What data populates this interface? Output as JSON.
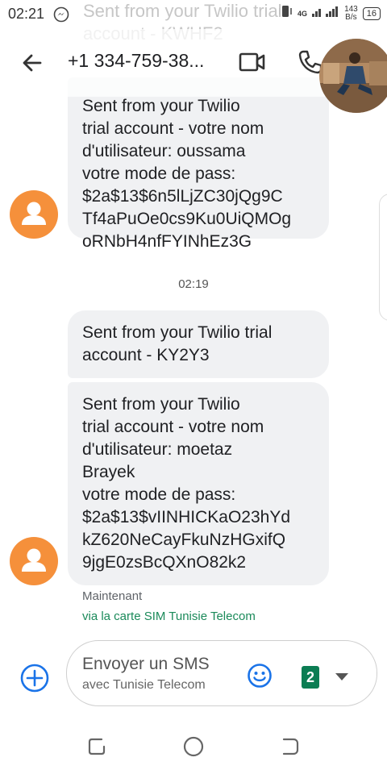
{
  "status_bar": {
    "time": "02:21",
    "network": "4G",
    "speed_value": "143",
    "speed_unit": "B/s",
    "battery": "16"
  },
  "background_text": "Sent from your Twilio trial\naccount - KWHF2",
  "header": {
    "phone_number": "+1 334-759-38...",
    "back_icon": "arrow-left-icon",
    "video_icon": "video-call-icon",
    "call_icon": "phone-icon"
  },
  "messages": [
    {
      "text": "Sent from your Twilio\ntrial account - votre nom\nd'utilisateur: oussama\nvotre mode de pass:\n$2a$13$6n5lLjZC30jQg9C\nTf4aPuOe0cs9Ku0UiQMOg\noRNbH4nfFYINhEz3G"
    },
    {
      "text": "Sent from your Twilio trial\naccount - KY2Y3"
    },
    {
      "text": "Sent from your Twilio\ntrial account - votre nom\nd'utilisateur: moetaz\nBrayek\nvotre mode de pass:\n$2a$13$vIINHICKaO23hYd\nkZ620NeCayFkuNzHGxifQ\n9jgE0zsBcQXnO82k2"
    }
  ],
  "separator_time": "02:19",
  "meta": {
    "status": "Maintenant",
    "sim": "via la carte SIM Tunisie Telecom"
  },
  "compose": {
    "placeholder": "Envoyer un SMS",
    "sub": "avec Tunisie Telecom",
    "sim_slot": "2"
  },
  "colors": {
    "accent": "#1a73e8",
    "contact_avatar": "#f5903b",
    "sim_badge": "#0b7d53",
    "sim_text": "#1b8a5a"
  }
}
